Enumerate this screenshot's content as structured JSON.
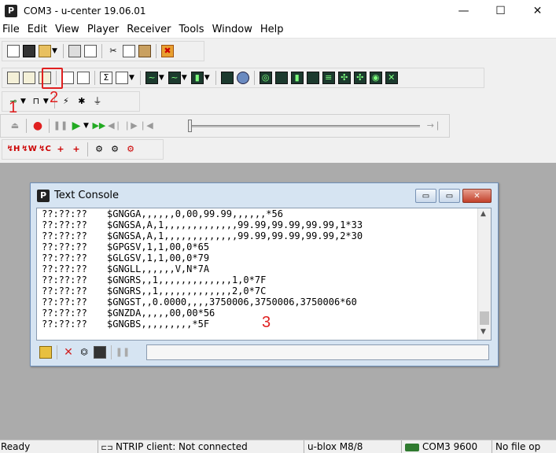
{
  "app": {
    "logo": "P",
    "title": "COM3 - u-center 19.06.01"
  },
  "window_buttons": {
    "minimize": "—",
    "maximize": "☐",
    "close": "✕"
  },
  "menu": [
    "File",
    "Edit",
    "View",
    "Player",
    "Receiver",
    "Tools",
    "Window",
    "Help"
  ],
  "annotations": {
    "one": "1",
    "two": "2",
    "three": "3"
  },
  "accent_colors": {
    "annotation": "#e02020",
    "record": "#e02020",
    "play": "#22aa22"
  },
  "toolbar_icons": {
    "row1": [
      "new-icon",
      "save-icon",
      "open-icon",
      "print-icon",
      "print-preview-icon",
      "cut-icon",
      "copy-icon",
      "paste-icon",
      "close-all-icon"
    ],
    "row2": [
      "text-console-icon",
      "binary-console-icon",
      "packet-console-icon",
      "messages-view-icon",
      "docking-view-icon",
      "statistics-view-icon",
      "table-view-icon",
      "chart-view-icon",
      "histogram-view-icon",
      "deviation-map-icon",
      "sky-view-icon",
      "map-view-icon",
      "navigation-view-icon",
      "satellite-view-icon",
      "signal-view-icon",
      "camera-view-icon",
      "gps-view-icon",
      "compass-view-icon",
      "settings-view-icon",
      "info-view-icon"
    ],
    "row3": [
      "connection-icon",
      "baudrate-icon",
      "autobauding-icon",
      "debug-icon",
      "ground-icon"
    ],
    "row4": [
      "eject-icon",
      "record-icon",
      "pause-icon",
      "play-icon",
      "fast-forward-icon",
      "step-back-icon",
      "step-forward-icon",
      "rewind-start-icon",
      "end-icon"
    ],
    "row5": [
      "hot-start-icon",
      "warm-start-icon",
      "cold-start-icon",
      "gnss-config-icon",
      "poll-icon",
      "settings-gear-icon",
      "settings-gear-2-icon",
      "settings-gear-3-icon"
    ]
  },
  "toolbar_text": {
    "hot": "H",
    "warm": "W",
    "cold": "C"
  },
  "console": {
    "logo": "P",
    "title": "Text Console",
    "buttons": {
      "minimize": "▭",
      "restore": "▭",
      "close": "✕"
    },
    "lines": [
      {
        "ts": "??:??:??",
        "msg": "$GNGGA,,,,,,0,00,99.99,,,,,,*56"
      },
      {
        "ts": "??:??:??",
        "msg": "$GNGSA,A,1,,,,,,,,,,,,,99.99,99.99,99.99,1*33"
      },
      {
        "ts": "??:??:??",
        "msg": "$GNGSA,A,1,,,,,,,,,,,,,99.99,99.99,99.99,2*30"
      },
      {
        "ts": "??:??:??",
        "msg": "$GPGSV,1,1,00,0*65"
      },
      {
        "ts": "??:??:??",
        "msg": "$GLGSV,1,1,00,0*79"
      },
      {
        "ts": "??:??:??",
        "msg": "$GNGLL,,,,,,V,N*7A"
      },
      {
        "ts": "??:??:??",
        "msg": "$GNGRS,,1,,,,,,,,,,,,,1,0*7F"
      },
      {
        "ts": "??:??:??",
        "msg": "$GNGRS,,1,,,,,,,,,,,,,2,0*7C"
      },
      {
        "ts": "??:??:??",
        "msg": "$GNGST,,0.0000,,,,3750006,3750006,3750006*60"
      },
      {
        "ts": "??:??:??",
        "msg": "$GNZDA,,,,,00,00*56"
      },
      {
        "ts": "??:??:??",
        "msg": "$GNGBS,,,,,,,,,*5F"
      }
    ],
    "footer_icons": [
      "lock-icon",
      "clear-icon",
      "poll-pc-icon",
      "save-console-icon",
      "pause-icon"
    ]
  },
  "status": {
    "ready": "Ready",
    "ntrip": "NTRIP client: Not connected",
    "receiver": "u-blox M8/8",
    "port": "COM3 9600",
    "file": "No file op"
  }
}
